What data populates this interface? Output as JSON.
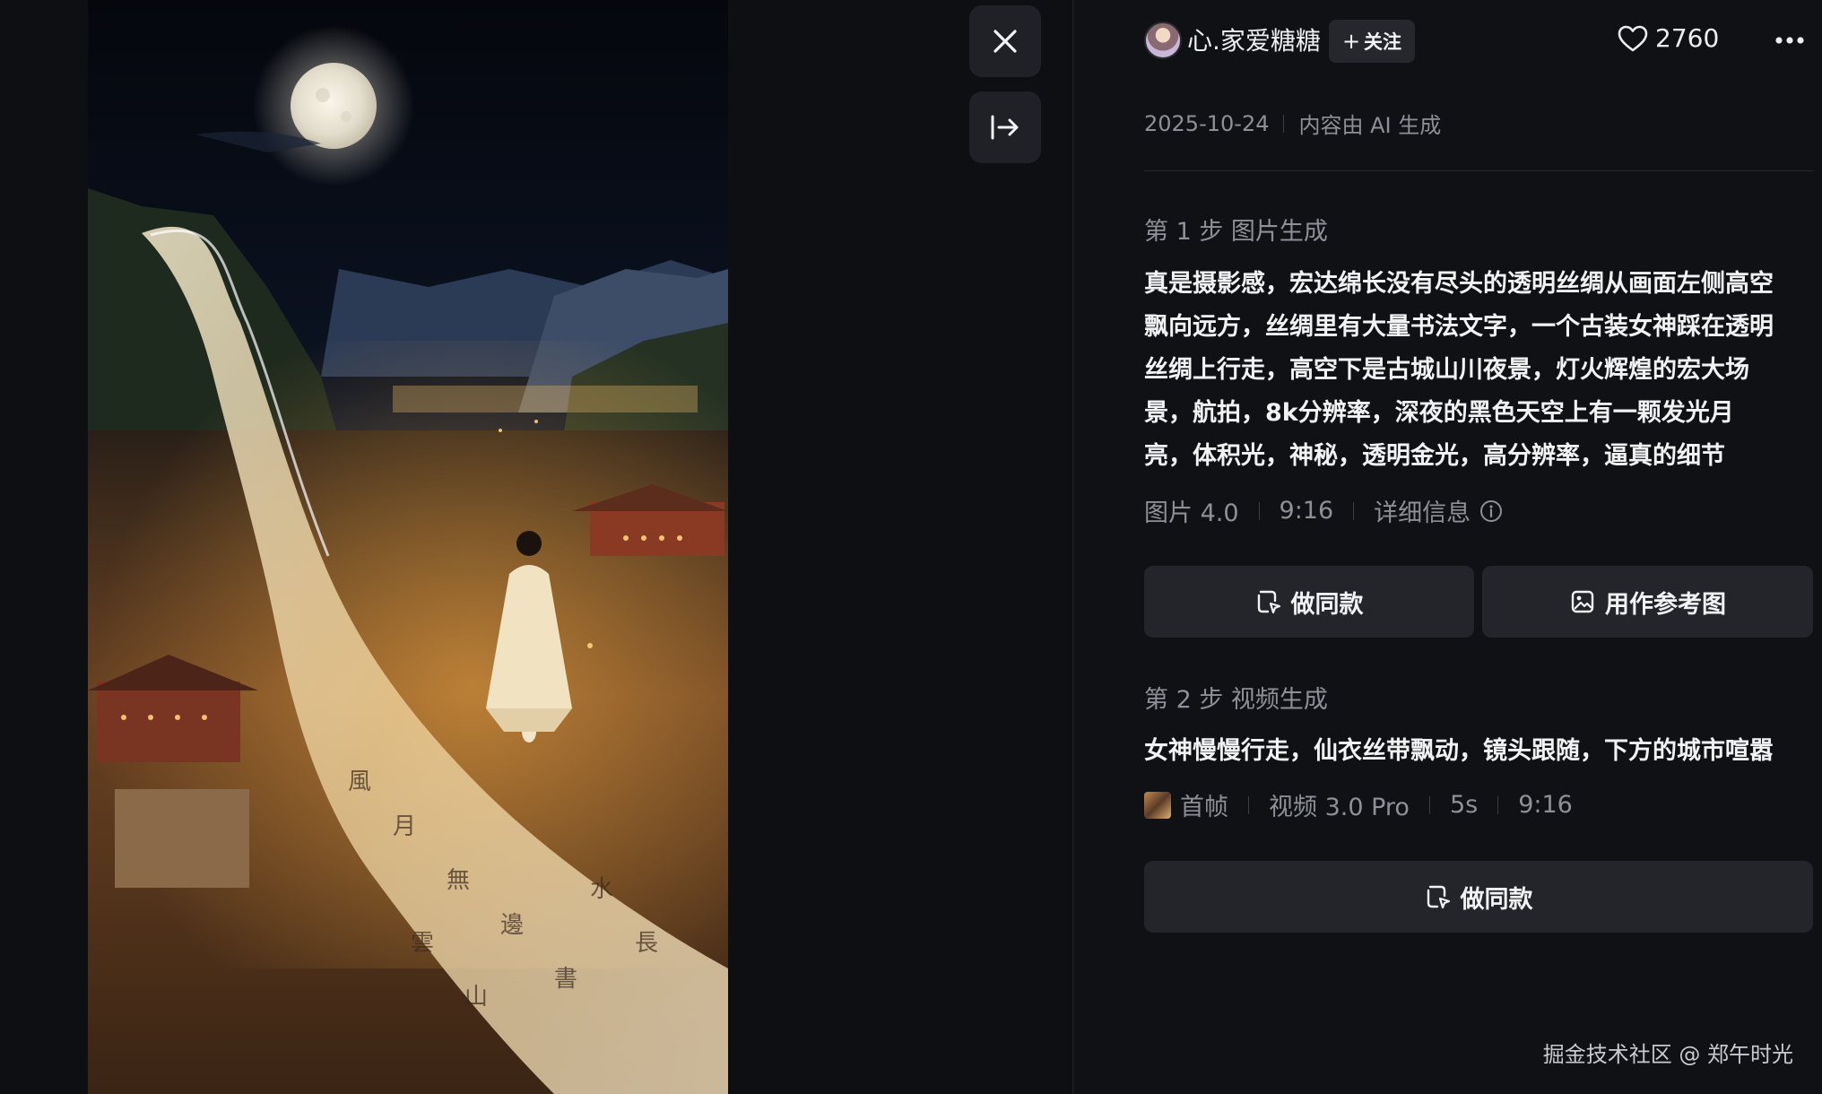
{
  "author": {
    "name": "心.家爱糖糖",
    "follow_label": "关注",
    "likes": "2760"
  },
  "meta": {
    "date": "2025-10-24",
    "ai_notice": "内容由 AI 生成"
  },
  "step1": {
    "title": "第 1 步 图片生成",
    "prompt": "真是摄影感，宏达绵长没有尽头的透明丝绸从画面左侧高空\n飘向远方，丝绸里有大量书法文字，一个古装女神踩在透明\n丝绸上行走，高空下是古城山川夜景，灯火辉煌的宏大场\n景，航拍，8k分辨率，深夜的黑色天空上有一颗发光月\n亮，体积光，神秘，透明金光，高分辨率，逼真的细节",
    "model": "图片 4.0",
    "ratio": "9:16",
    "detail_label": "详细信息",
    "make_same_label": "做同款",
    "use_reference_label": "用作参考图"
  },
  "step2": {
    "title": "第 2 步 视频生成",
    "prompt": "女神慢慢行走，仙衣丝带飘动，镜头跟随，下方的城市喧嚣",
    "first_frame_label": "首帧",
    "model": "视频 3.0 Pro",
    "duration": "5s",
    "ratio": "9:16",
    "make_same_label": "做同款"
  },
  "watermark": "掘金技术社区 @ 郑午时光",
  "icons": {
    "close": "close-icon",
    "collapse": "collapse-panel-icon",
    "heart": "heart-icon",
    "more": "more-dots-icon",
    "info": "info-icon",
    "make_same": "make-same-icon",
    "reference": "image-reference-icon"
  },
  "colors": {
    "background": "#101114",
    "button": "#23252a",
    "muted_text": "#8d9097",
    "primary_text": "#f1f2f4"
  }
}
